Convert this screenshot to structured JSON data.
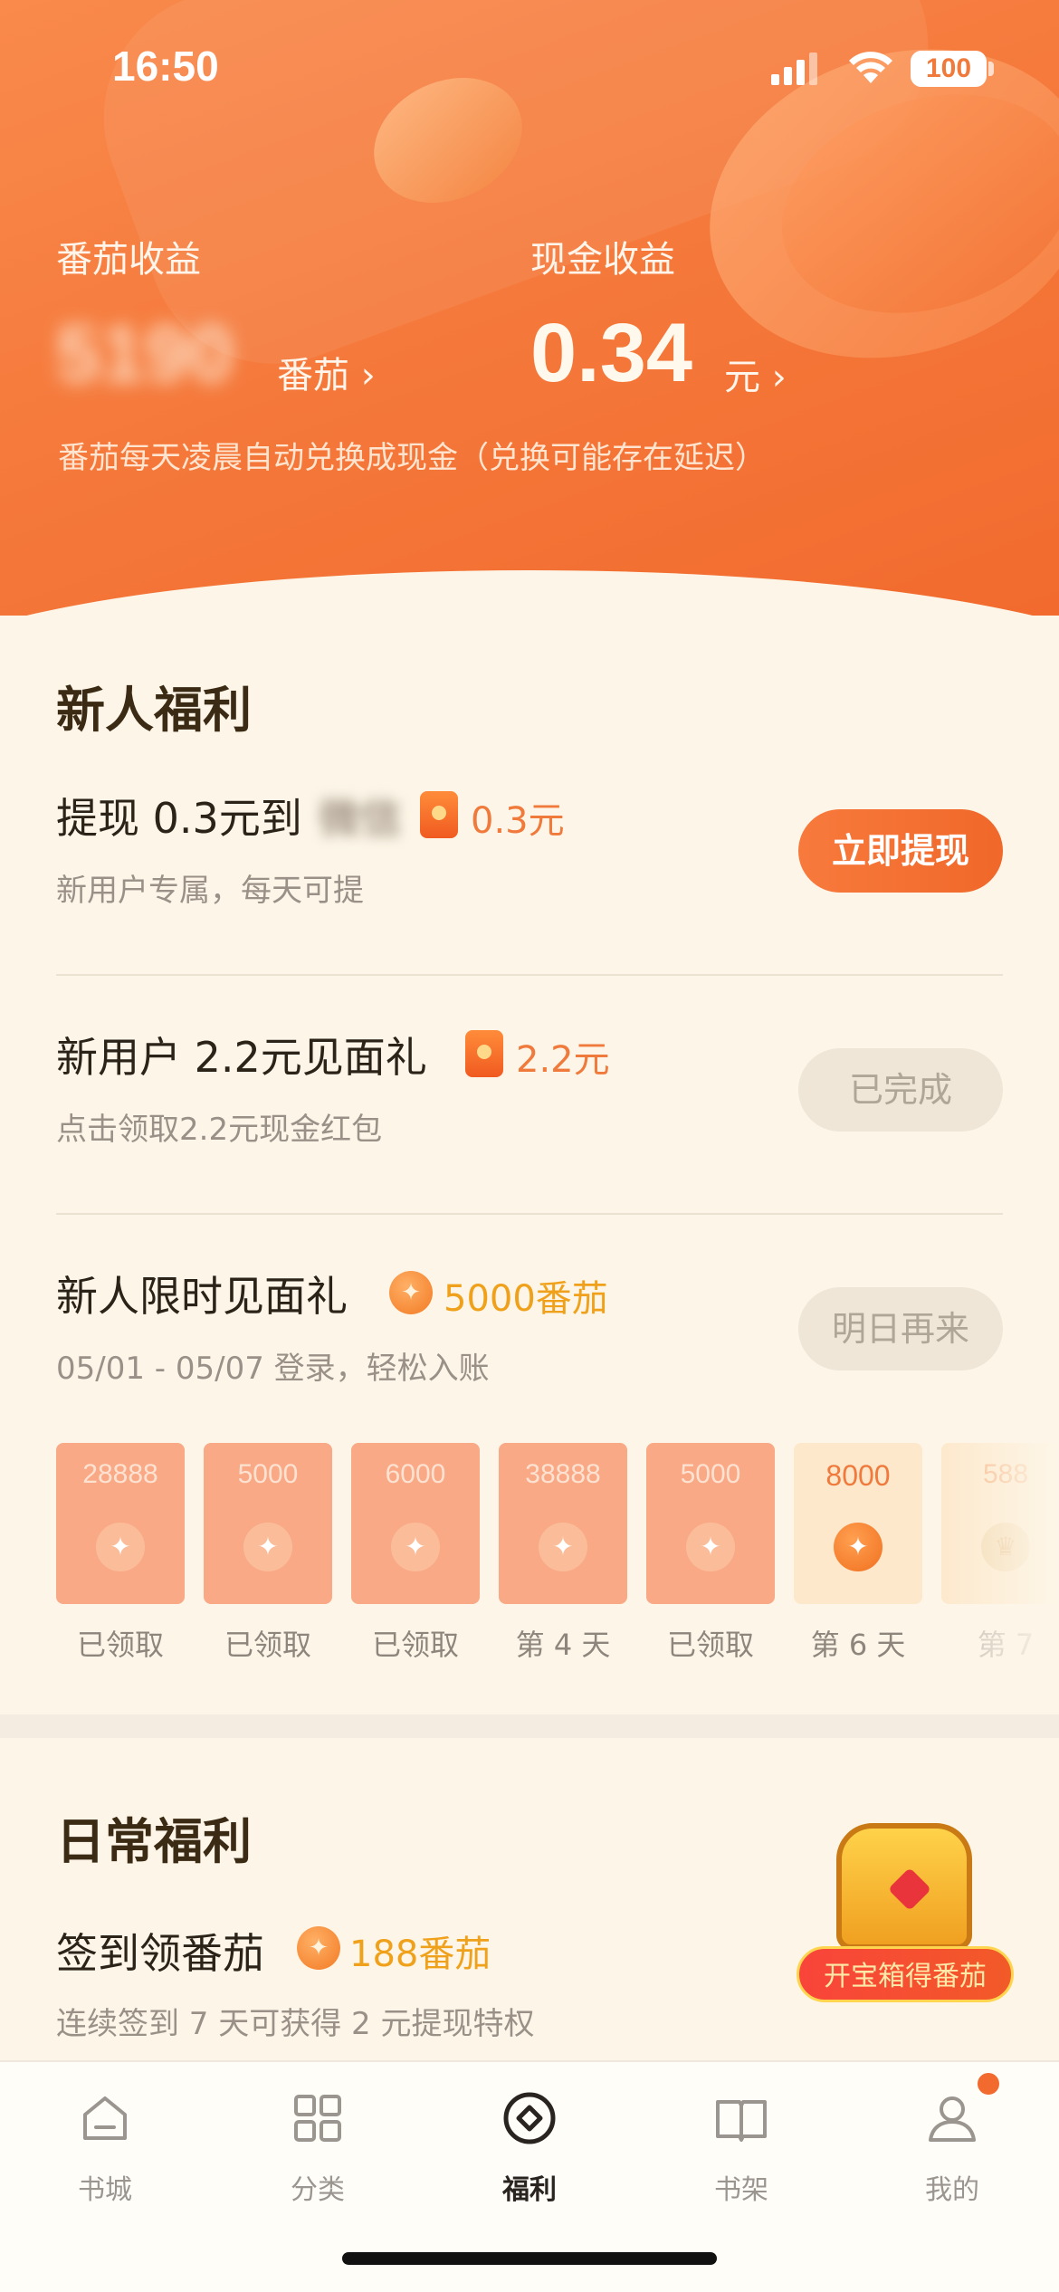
{
  "status_bar": {
    "time": "16:50",
    "battery": "100"
  },
  "header": {
    "tomato_label": "番茄收益",
    "tomato_value": "5190",
    "tomato_unit": "番茄 ›",
    "cash_label": "现金收益",
    "cash_value": "0.34",
    "cash_unit": "元 ›",
    "note": "番茄每天凌晨自动兑换成现金（兑换可能存在延迟）"
  },
  "newcomer": {
    "title": "新人福利",
    "withdraw": {
      "title": "提现 0.3元到",
      "target_blurred": "微信",
      "reward": "0.3元",
      "sub": "新用户专属，每天可提",
      "button": "立即提现"
    },
    "gift": {
      "title": "新用户 2.2元见面礼",
      "reward": "2.2元",
      "sub": "点击领取2.2元现金红包",
      "button": "已完成"
    },
    "limited": {
      "title": "新人限时见面礼",
      "reward": "5000番茄",
      "sub": "05/01 - 05/07 登录，轻松入账",
      "button": "明日再来",
      "days": [
        {
          "amount": "28888",
          "label": "已领取"
        },
        {
          "amount": "5000",
          "label": "已领取"
        },
        {
          "amount": "6000",
          "label": "已领取"
        },
        {
          "amount": "38888",
          "label": "第 4 天"
        },
        {
          "amount": "5000",
          "label": "已领取"
        },
        {
          "amount": "8000",
          "label": "第 6 天"
        },
        {
          "amount": "588",
          "label": "第 7"
        }
      ]
    }
  },
  "daily": {
    "title": "日常福利",
    "checkin_title": "签到领番茄",
    "checkin_reward": "188番茄",
    "checkin_sub": "连续签到 7 天可获得 2 元提现特权",
    "chest_label": "开宝箱得番茄"
  },
  "tabs": [
    {
      "label": "书城",
      "icon": "home-icon"
    },
    {
      "label": "分类",
      "icon": "grid-icon"
    },
    {
      "label": "福利",
      "icon": "coin-icon"
    },
    {
      "label": "书架",
      "icon": "book-icon"
    },
    {
      "label": "我的",
      "icon": "user-icon"
    }
  ],
  "colors": {
    "accent": "#f26a2e",
    "gold": "#f0a11c",
    "background": "#fdf6e8"
  }
}
